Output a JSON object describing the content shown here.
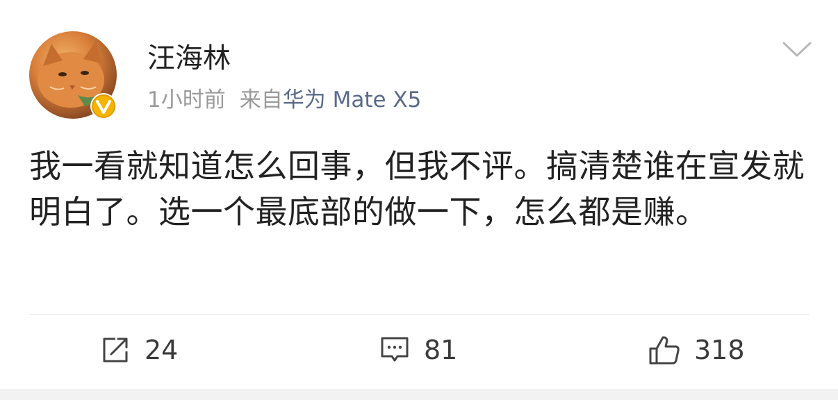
{
  "post": {
    "author": "汪海林",
    "time": "1小时前",
    "source_prefix": "来自",
    "source_device": "华为 Mate X5",
    "text": "我一看就知道怎么回事，但我不评。搞清楚谁在宣发就明白了。选一个最底部的做一下，怎么都是赚。"
  },
  "actions": {
    "repost_count": "24",
    "comment_count": "81",
    "like_count": "318"
  },
  "icons": {
    "repost": "share-icon",
    "comment": "comment-icon",
    "like": "thumbs-up-icon",
    "menu": "chevron-down-icon",
    "badge": "verified-v-icon"
  },
  "colors": {
    "text": "#222222",
    "meta": "#9a9a9a",
    "device": "#5a6a8a",
    "badge_fill": "#f5b400"
  }
}
